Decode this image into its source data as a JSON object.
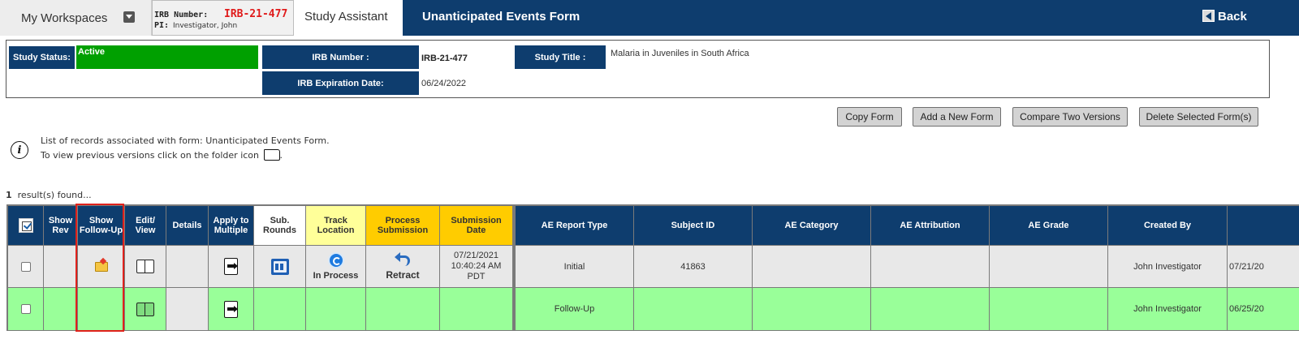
{
  "topbar": {
    "workspaces_label": "My Workspaces",
    "irb_label": "IRB Number:",
    "irb_number": "IRB-21-477",
    "pi_label": "PI:",
    "pi_name": "Investigator, John",
    "assistant_tab": "Study Assistant",
    "form_title": "Unanticipated Events Form",
    "back_label": "Back"
  },
  "study": {
    "status_label": "Study Status:",
    "status_value": "Active",
    "irb_label": "IRB Number :",
    "irb_value": "IRB-21-477",
    "expiration_label": "IRB Expiration Date:",
    "expiration_value": "06/24/2022",
    "title_label": "Study Title :",
    "title_value": "Malaria in Juveniles in South Africa"
  },
  "actions": {
    "copy": "Copy Form",
    "add": "Add a New Form",
    "compare": "Compare Two Versions",
    "delete": "Delete Selected Form(s)"
  },
  "info": {
    "line1": "List of records associated with form: Unanticipated Events Form.",
    "line2": "To view previous versions click on the folder icon",
    "line2_end": "."
  },
  "results": {
    "count": "1",
    "text": "result(s) found..."
  },
  "table": {
    "headers": {
      "show_rev": "Show Rev",
      "show_followup": "Show Follow-Up",
      "edit_view": "Edit/ View",
      "details": "Details",
      "apply_multiple": "Apply to Multiple",
      "sub_rounds": "Sub. Rounds",
      "track_location": "Track Location",
      "process_submission": "Process Submission",
      "submission_date": "Submission Date",
      "ae_report_type": "AE Report Type",
      "subject_id": "Subject ID",
      "ae_category": "AE Category",
      "ae_attribution": "AE Attribution",
      "ae_grade": "AE Grade",
      "created_by": "Created By"
    },
    "rows": [
      {
        "track_label": "In Process",
        "process_label": "Retract",
        "submission_date_line1": "07/21/2021",
        "submission_date_line2": "10:40:24 AM",
        "submission_date_line3": "PDT",
        "ae_report_type": "Initial",
        "subject_id": "41863",
        "created_by": "John Investigator",
        "date_partial": "07/21/20"
      },
      {
        "ae_report_type": "Follow-Up",
        "created_by": "John Investigator",
        "date_partial": "06/25/20"
      }
    ]
  },
  "colors": {
    "navy": "#0e3d6e",
    "active_green": "#00a000",
    "row_green": "#99ff99",
    "row_gray": "#e8e8e8",
    "irb_red": "#e01b1b",
    "highlight_red": "#e0211b",
    "track_yellow": "#ffff99",
    "process_gold": "#ffcc00"
  }
}
